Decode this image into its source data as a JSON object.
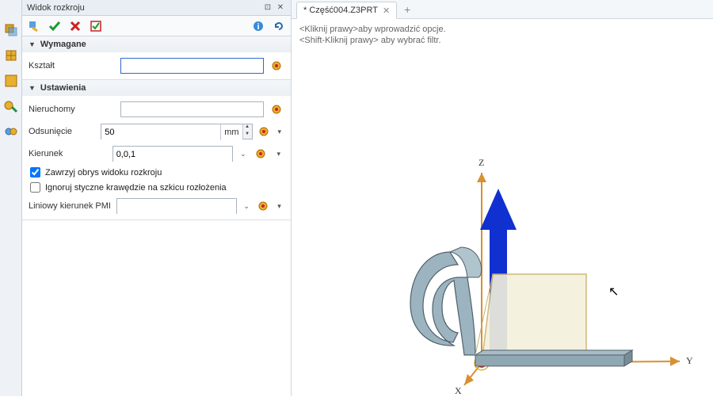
{
  "panel": {
    "title": "Widok rozkroju",
    "sections": {
      "required": {
        "header": "Wymagane",
        "shape_label": "Kształt",
        "shape_value": ""
      },
      "settings": {
        "header": "Ustawienia",
        "fixed_label": "Nieruchomy",
        "fixed_value": "",
        "offset_label": "Odsunięcie",
        "offset_value": "50",
        "offset_unit": "mm",
        "direction_label": "Kierunek",
        "direction_value": "0,0,1",
        "check1": "Zawrzyj obrys widoku rozkroju",
        "check2": "Ignoruj styczne krawędzie na szkicu rozłożenia",
        "pmi_label": "Liniowy kierunek PMI",
        "pmi_value": ""
      }
    }
  },
  "tab": {
    "label": " * Część004.Z3PRT "
  },
  "hints": {
    "line1": "<Kliknij prawy>aby wprowadzić opcje.",
    "line2": "<Shift-Kliknij prawy> aby wybrać filtr."
  },
  "axes": {
    "x": "X",
    "y": "Y",
    "z": "Z"
  },
  "checks": {
    "c1": true,
    "c2": false
  }
}
